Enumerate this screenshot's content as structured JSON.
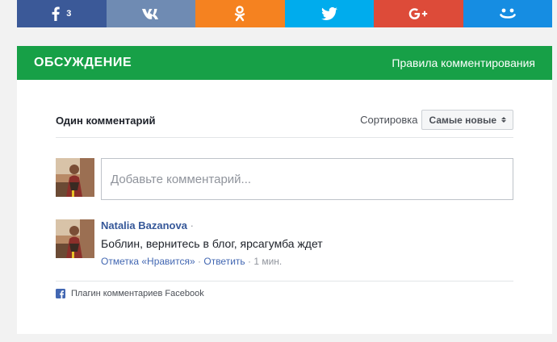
{
  "share_bar": {
    "buttons": [
      {
        "icon": "facebook-icon",
        "color": "#3b5998",
        "count": "3"
      },
      {
        "icon": "vk-icon",
        "color": "#6f8bb3"
      },
      {
        "icon": "odnoklassniki-icon",
        "color": "#f58220"
      },
      {
        "icon": "twitter-icon",
        "color": "#00aced"
      },
      {
        "icon": "google-plus-icon",
        "color": "#dd4b39"
      },
      {
        "icon": "moi-mir-icon",
        "color": "#168de2"
      }
    ]
  },
  "discussion": {
    "title": "ОБСУЖДЕНИЕ",
    "rules_link": "Правила комментирования",
    "accent_color": "#17a047"
  },
  "comments": {
    "count_label": "Один комментарий",
    "sort_label": "Сортировка",
    "sort_selected": "Самые новые",
    "compose_placeholder": "Добавьте комментарий...",
    "items": [
      {
        "author": "Natalia Bazanova",
        "author_sep": "·",
        "text": "Боблин, вернитесь в блог, ярсагумба ждет",
        "like": "Отметка «Нравится»",
        "sep1": "·",
        "reply": "Ответить",
        "sep2": "·",
        "time": "1 мин."
      }
    ],
    "footer": "Плагин комментариев Facebook"
  }
}
